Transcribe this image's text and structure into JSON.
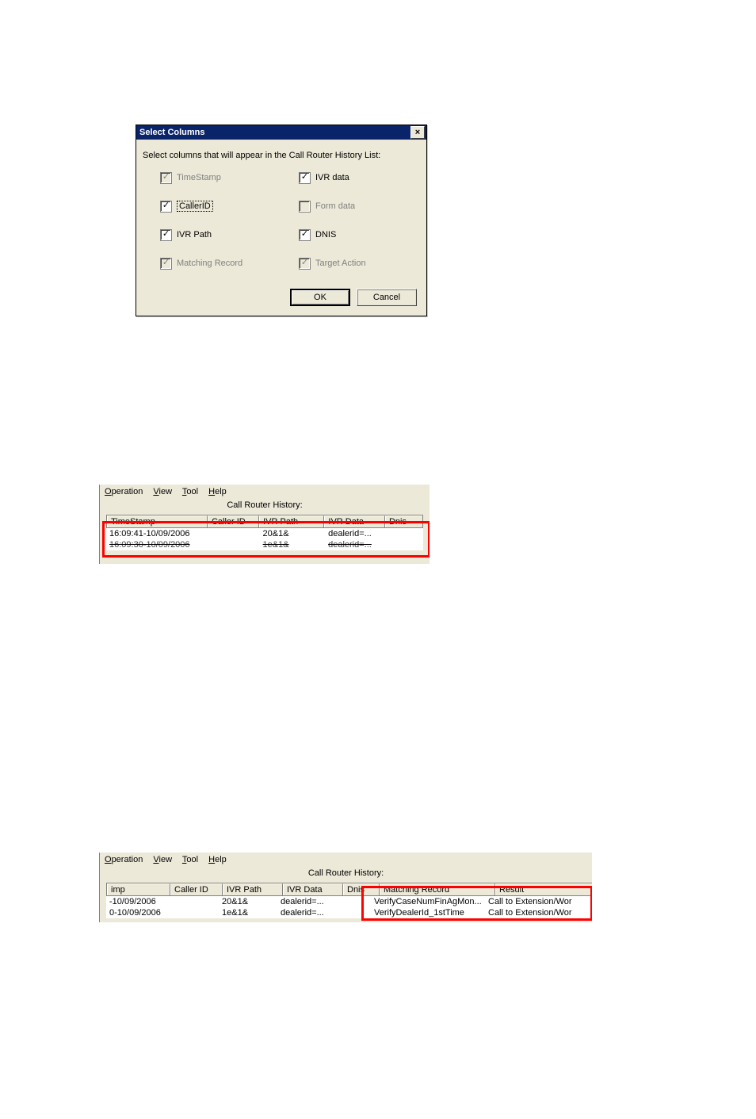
{
  "dialog": {
    "title": "Select Columns",
    "instruction": "Select columns that will appear in the Call Router History List:",
    "left": [
      {
        "label": "TimeStamp",
        "checked": true,
        "disabled": true,
        "focused": false
      },
      {
        "label": "CallerID",
        "checked": true,
        "disabled": false,
        "focused": true
      },
      {
        "label": "IVR Path",
        "checked": true,
        "disabled": false,
        "focused": false
      },
      {
        "label": "Matching Record",
        "checked": true,
        "disabled": true,
        "focused": false
      }
    ],
    "right": [
      {
        "label": "IVR data",
        "checked": true,
        "disabled": false,
        "focused": false
      },
      {
        "label": "Form data",
        "checked": false,
        "disabled": true,
        "focused": false
      },
      {
        "label": "DNIS",
        "checked": true,
        "disabled": false,
        "focused": false
      },
      {
        "label": "Target Action",
        "checked": true,
        "disabled": true,
        "focused": false
      }
    ],
    "ok_label": "OK",
    "cancel_label": "Cancel",
    "close_label": "×"
  },
  "menus": {
    "operation": "Operation",
    "view": "View",
    "tool": "Tool",
    "help": "Help"
  },
  "history_caption": "Call Router History:",
  "panel2": {
    "headers": [
      "TimeStamp",
      "Caller ID",
      "IVR Path",
      "IVR Data",
      "Dnis"
    ],
    "rows": [
      {
        "cells": [
          "16:09:41-10/09/2006",
          "",
          "20&1&",
          "dealerid=...",
          ""
        ],
        "struck": false
      },
      {
        "cells": [
          "16:09:30-10/09/2006",
          "",
          "1e&1&",
          "dealerid=...",
          ""
        ],
        "struck": true
      }
    ]
  },
  "panel3": {
    "headers": [
      "imp",
      "Caller ID",
      "IVR Path",
      "IVR Data",
      "Dnis",
      "Matching Record",
      "Result"
    ],
    "rows": [
      {
        "cells": [
          "-10/09/2006",
          "",
          "20&1&",
          "dealerid=...",
          "",
          "VerifyCaseNumFinAgMon...",
          "Call to Extension/Wor"
        ]
      },
      {
        "cells": [
          "0-10/09/2006",
          "",
          "1e&1&",
          "dealerid=...",
          "",
          "VerifyDealerId_1stTime",
          "Call to Extension/Wor"
        ]
      }
    ],
    "scroll_up_glyph": "▴"
  }
}
